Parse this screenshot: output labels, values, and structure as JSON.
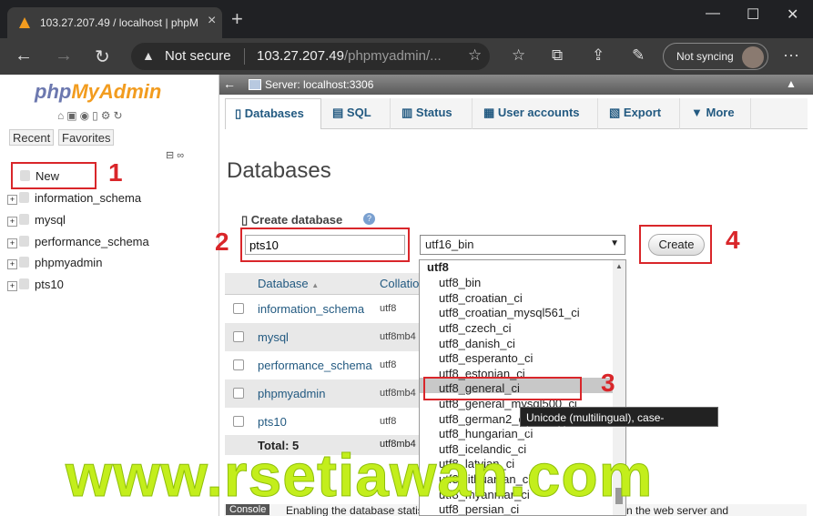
{
  "browser": {
    "tab_title": "103.27.207.49 / localhost | phpM",
    "not_secure": "Not secure",
    "url_main": "103.27.207.49",
    "url_path": "/phpmyadmin/...",
    "sync_label": "Not syncing"
  },
  "sidebar": {
    "logo_php": "php",
    "logo_myadmin": "MyAdmin",
    "recent": "Recent",
    "favorites": "Favorites",
    "items": [
      {
        "label": "New"
      },
      {
        "label": "information_schema"
      },
      {
        "label": "mysql"
      },
      {
        "label": "performance_schema"
      },
      {
        "label": "phpmyadmin"
      },
      {
        "label": "pts10"
      }
    ]
  },
  "main": {
    "server_label": "Server: localhost:3306",
    "tabs": [
      {
        "label": "Databases"
      },
      {
        "label": "SQL"
      },
      {
        "label": "Status"
      },
      {
        "label": "User accounts"
      },
      {
        "label": "Export"
      },
      {
        "label": "More"
      }
    ],
    "heading": "Databases",
    "create_label": "Create database",
    "db_name_value": "pts10",
    "collation_value": "utf16_bin",
    "create_button": "Create",
    "table": {
      "col_database": "Database",
      "col_collation": "Collatio",
      "rows": [
        {
          "name": "information_schema",
          "coll": "utf8"
        },
        {
          "name": "mysql",
          "coll": "utf8mb4"
        },
        {
          "name": "performance_schema",
          "coll": "utf8"
        },
        {
          "name": "phpmyadmin",
          "coll": "utf8mb4"
        },
        {
          "name": "pts10",
          "coll": "utf8"
        }
      ],
      "total_label": "Total: 5",
      "total_coll": "utf8mb4"
    },
    "console_button": "Console",
    "console_text": "Enabling the database statistics here might cause heavy traffic between the web server and"
  },
  "dropdown": {
    "group": "utf8",
    "options": [
      "utf8_bin",
      "utf8_croatian_ci",
      "utf8_croatian_mysql561_ci",
      "utf8_czech_ci",
      "utf8_danish_ci",
      "utf8_esperanto_ci",
      "utf8_estonian_ci",
      "utf8_general_ci",
      "utf8_general_mysql500_ci",
      "utf8_german2_ci",
      "utf8_hungarian_ci",
      "utf8_icelandic_ci",
      "utf8_latvian_ci",
      "utf8_lithuanian_ci",
      "utf8_myanmar_ci",
      "utf8_persian_ci"
    ],
    "selected": "utf8_general_ci"
  },
  "tooltip": "Unicode (multilingual), case-insensitive",
  "annotations": {
    "n1": "1",
    "n2": "2",
    "n3": "3",
    "n4": "4"
  },
  "watermark": "www.rsetiawan.com",
  "colors": {
    "accent_red": "#d9262a",
    "watermark": "#c3ee1c",
    "link": "#235a81"
  }
}
